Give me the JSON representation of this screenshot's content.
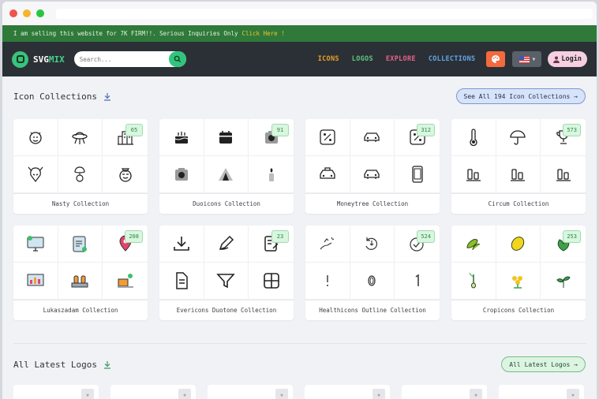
{
  "banner": {
    "text": "I am selling this website for 7K FIRM!!. Serious Inquiries Only",
    "link": "Click Here !"
  },
  "brand": {
    "prefix": "SVG",
    "suffix": "MIX"
  },
  "search": {
    "placeholder": "Search..."
  },
  "nav": [
    {
      "label": "ICONS",
      "color": "#e6a224"
    },
    {
      "label": "LOGOS",
      "color": "#5fc77d"
    },
    {
      "label": "EXPLORE",
      "color": "#e8608a"
    },
    {
      "label": "COLLECTIONS",
      "color": "#63a6e8"
    }
  ],
  "login_label": "Login",
  "icons_section": {
    "title": "Icon Collections",
    "cta": "See All 194 Icon Collections →"
  },
  "collections": [
    {
      "name": "Nasty Collection",
      "count": "65",
      "icons": [
        "face-icon",
        "ufo-icon",
        "city-icon",
        "alien-icon",
        "bomb-icon",
        "world-icon"
      ]
    },
    {
      "name": "Duoicons Collection",
      "count": "91",
      "icons": [
        "cake-icon",
        "calendar-icon",
        "camera-icon",
        "camera-icon",
        "tent-icon",
        "candle-icon"
      ]
    },
    {
      "name": "Moneytree Collection",
      "count": "312",
      "icons": [
        "percent-icon",
        "car-icon",
        "percent-icon",
        "taxi-icon",
        "car-icon",
        "phone-icon"
      ]
    },
    {
      "name": "Circum Collection",
      "count": "573",
      "icons": [
        "thermometer-icon",
        "umbrella-icon",
        "trophy-icon",
        "align-icon",
        "align-icon",
        "align-icon"
      ]
    },
    {
      "name": "Lukaszadam Collection",
      "count": "208",
      "icons": [
        "monitor-icon",
        "clipboard-icon",
        "pin-icon",
        "chart-icon",
        "factory-icon",
        "box-icon"
      ]
    },
    {
      "name": "Evericons Duotone Collection",
      "count": "23",
      "icons": [
        "download-icon",
        "pen-icon",
        "note-icon",
        "document-icon",
        "filter-icon",
        "grid-icon"
      ]
    },
    {
      "name": "Healthicons Outline Collection",
      "count": "524",
      "icons": [
        "hand-icon",
        "refresh-icon",
        "check-circle-icon",
        "exclamation-icon",
        "zero-icon",
        "one-icon"
      ]
    },
    {
      "name": "Cropicons Collection",
      "count": "253",
      "icons": [
        "beans-icon",
        "lemon-icon",
        "leaf-icon",
        "sprout-icon",
        "flower-icon",
        "plant-icon"
      ]
    }
  ],
  "logos_section": {
    "title": "All Latest Logos",
    "cta": "All Latest Logos →"
  },
  "colors": {
    "accent": "#32c47c",
    "banner": "#2f7a3a",
    "nav": "#2b3036"
  }
}
